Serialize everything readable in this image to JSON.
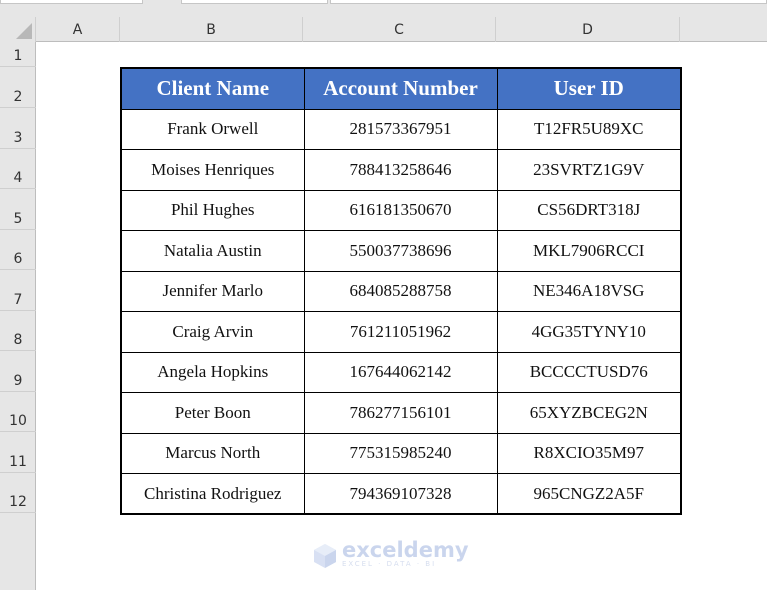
{
  "sheet": {
    "columns": [
      "A",
      "B",
      "C",
      "D",
      ""
    ],
    "rows": [
      "1",
      "2",
      "3",
      "4",
      "5",
      "6",
      "7",
      "8",
      "9",
      "10",
      "11",
      "12"
    ]
  },
  "table": {
    "headers": [
      "Client Name",
      "Account Number",
      "User ID"
    ],
    "rows": [
      [
        "Frank Orwell",
        "281573367951",
        "T12FR5U89XC"
      ],
      [
        "Moises Henriques",
        "788413258646",
        "23SVRTZ1G9V"
      ],
      [
        "Phil Hughes",
        "616181350670",
        "CS56DRT318J"
      ],
      [
        "Natalia Austin",
        "550037738696",
        "MKL7906RCCI"
      ],
      [
        "Jennifer Marlo",
        "684085288758",
        "NE346A18VSG"
      ],
      [
        "Craig Arvin",
        "761211051962",
        "4GG35TYNY10"
      ],
      [
        "Angela Hopkins",
        "167644062142",
        "BCCCCTUSD76"
      ],
      [
        "Peter Boon",
        "786277156101",
        "65XYZBCEG2N"
      ],
      [
        "Marcus North",
        "775315985240",
        "R8XCIO35M97"
      ],
      [
        "Christina Rodriguez",
        "794369107328",
        "965CNGZ2A5F"
      ]
    ]
  },
  "colors": {
    "header_fill": "#4472c4",
    "header_text": "#ffffff"
  },
  "watermark": {
    "brand": "exceldemy",
    "tagline": "EXCEL · DATA · BI"
  }
}
